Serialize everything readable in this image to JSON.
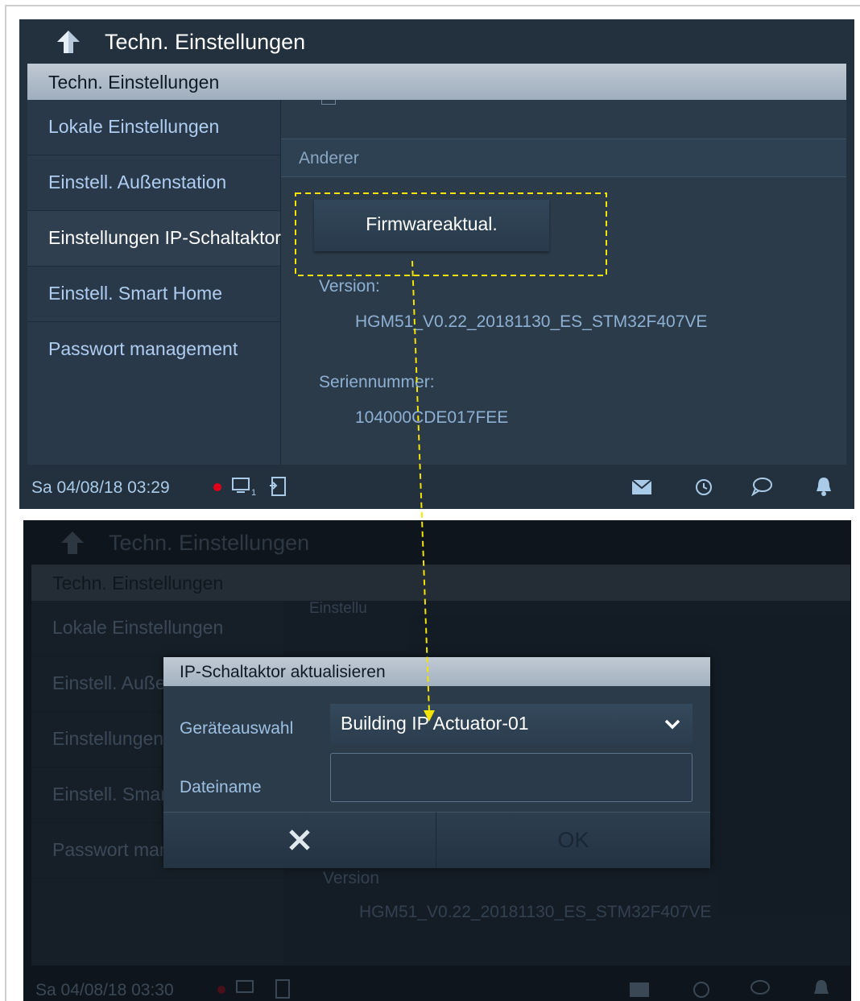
{
  "screen1": {
    "title": "Techn. Einstellungen",
    "tab_header": "Techn. Einstellungen",
    "sidebar": [
      {
        "label": "Lokale Einstellungen",
        "active": false
      },
      {
        "label": "Einstell. Außenstation",
        "active": false
      },
      {
        "label": "Einstellungen IP-Schaltaktor",
        "active": true
      },
      {
        "label": "Einstell. Smart Home",
        "active": false
      },
      {
        "label": "Passwort management",
        "active": false
      }
    ],
    "section_label": "Anderer",
    "firmware_button": "Firmwareaktual.",
    "version_label": "Version:",
    "version_value": "HGM51_V0.22_20181130_ES_STM32F407VE",
    "serial_label": "Seriennummer:",
    "serial_value": "104000CDE017FEE",
    "status_datetime": "Sa 04/08/18  03:29"
  },
  "screen2": {
    "title": "Techn. Einstellungen",
    "tab_header": "Techn. Einstellungen",
    "section_label": "Einstellu",
    "sidebar": [
      "Lokale Einstellungen",
      "Einstell. Außenstation",
      "Einstellungen IP-Schaltaktor",
      "Einstell. Smart Home",
      "Passwort management"
    ],
    "version_label": "Version",
    "version_value": "HGM51_V0.22_20181130_ES_STM32F407VE",
    "status_datetime": "Sa 04/08/18  03:30",
    "dialog": {
      "title": "IP-Schaltaktor aktualisieren",
      "device_label": "Geräteauswahl",
      "device_value": "Building IP Actuator-01",
      "filename_label": "Dateiname",
      "filename_value": "",
      "ok_label": "OK"
    }
  },
  "colors": {
    "screen_bg": "#23303d",
    "panel_bg": "#2c3b4a",
    "header_bar": "#a3b1bf",
    "text_light_blue": "#aecdf0",
    "highlight_dash": "#f5e400",
    "record_dot": "#e0001a"
  },
  "icons": [
    "back-arrow-icon",
    "record-dot-icon",
    "monitor-icon",
    "door-exit-icon",
    "mail-icon",
    "history-icon",
    "chat-icon",
    "bell-icon",
    "chevron-down-icon",
    "close-icon"
  ]
}
